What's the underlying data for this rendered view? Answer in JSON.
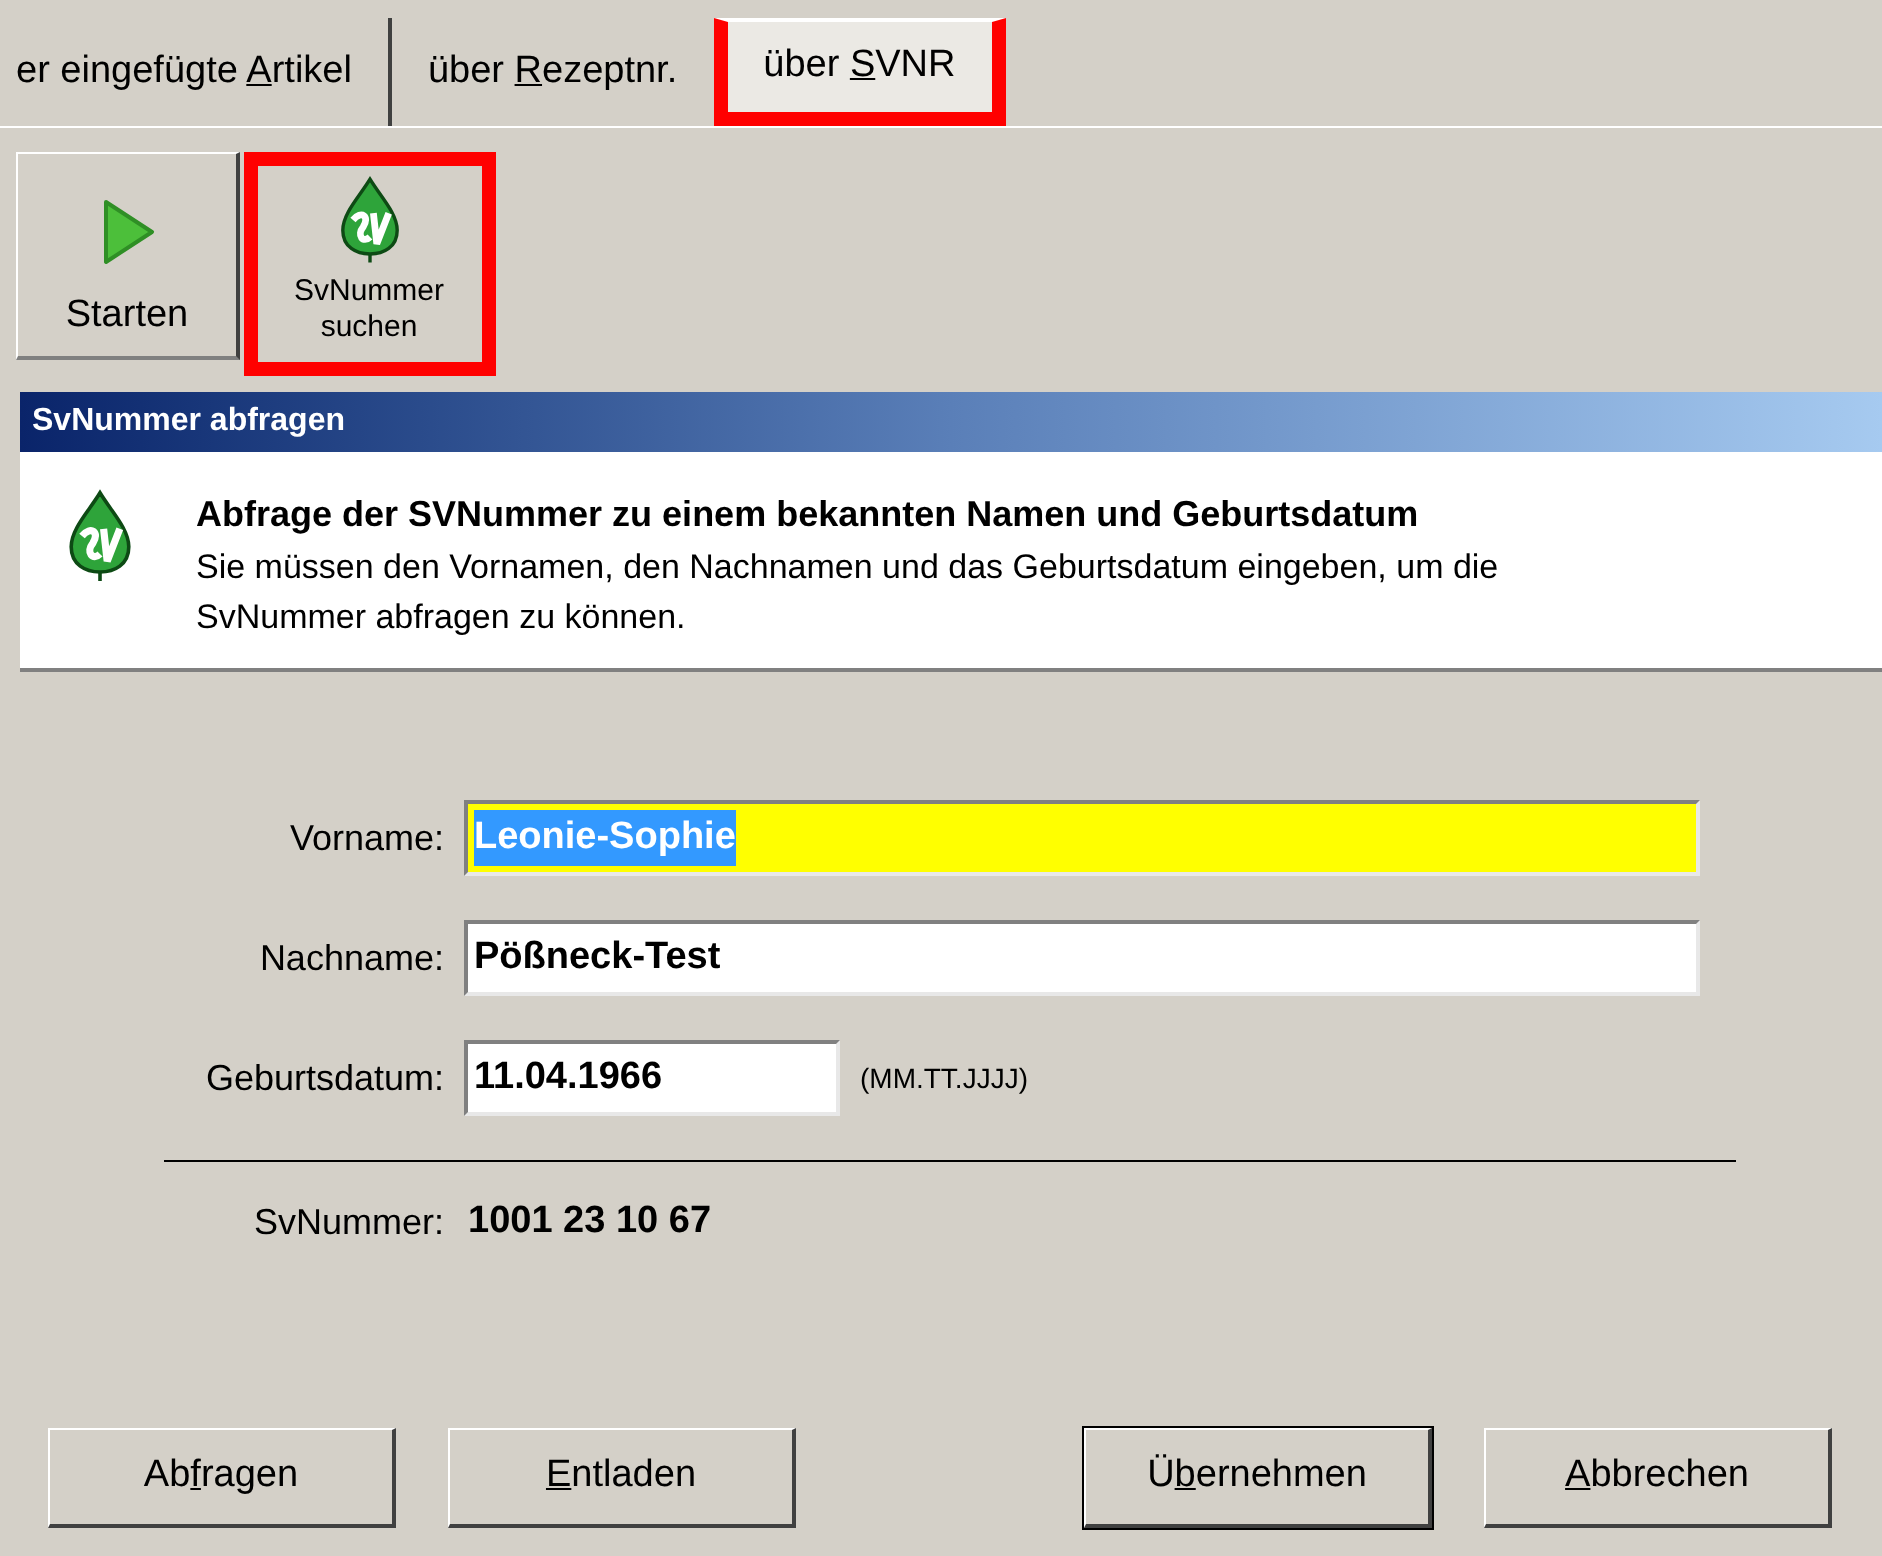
{
  "tabs": [
    {
      "pre": "er eingefügte ",
      "key": "A",
      "post": "rtikel",
      "selected": false,
      "highlighted": false
    },
    {
      "pre": "über ",
      "key": "R",
      "post": "ezeptnr.",
      "selected": false,
      "highlighted": false
    },
    {
      "pre": "über ",
      "key": "S",
      "post": "VNR",
      "selected": true,
      "highlighted": true
    }
  ],
  "toolbar": [
    {
      "kind": "play",
      "label": "Starten",
      "highlighted": false
    },
    {
      "kind": "sv",
      "label": "SvNummer suchen",
      "highlighted": true
    }
  ],
  "panel_title": "SvNummer abfragen",
  "info": {
    "heading": "Abfrage der SVNummer zu einem bekannten Namen und Geburtsdatum",
    "text": "Sie müssen den Vornamen, den Nachnamen und das Geburtsdatum eingeben, um die SvNummer abfragen zu können."
  },
  "fields": [
    {
      "label": "Vorname:",
      "value": "Leonie-Sophie",
      "focused": true,
      "text_selected": true,
      "kind": "wide"
    },
    {
      "label": "Nachname:",
      "value": "Pößneck-Test",
      "focused": false,
      "text_selected": false,
      "kind": "wide"
    },
    {
      "label": "Geburtsdatum:",
      "value": "11.04.1966",
      "focused": false,
      "text_selected": false,
      "kind": "date",
      "hint": "(MM.TT.JJJJ)"
    }
  ],
  "result": {
    "label": "SvNummer:",
    "value": "1001 23 10 67"
  },
  "buttons": [
    {
      "pre": "Ab",
      "key": "f",
      "post": "ragen",
      "default": false
    },
    {
      "key": "E",
      "post": "ntladen",
      "default": false
    },
    {
      "pre": "Ü",
      "key": "b",
      "post": "ernehmen",
      "default": true
    },
    {
      "key": "A",
      "post": "bbrechen",
      "default": false
    }
  ]
}
